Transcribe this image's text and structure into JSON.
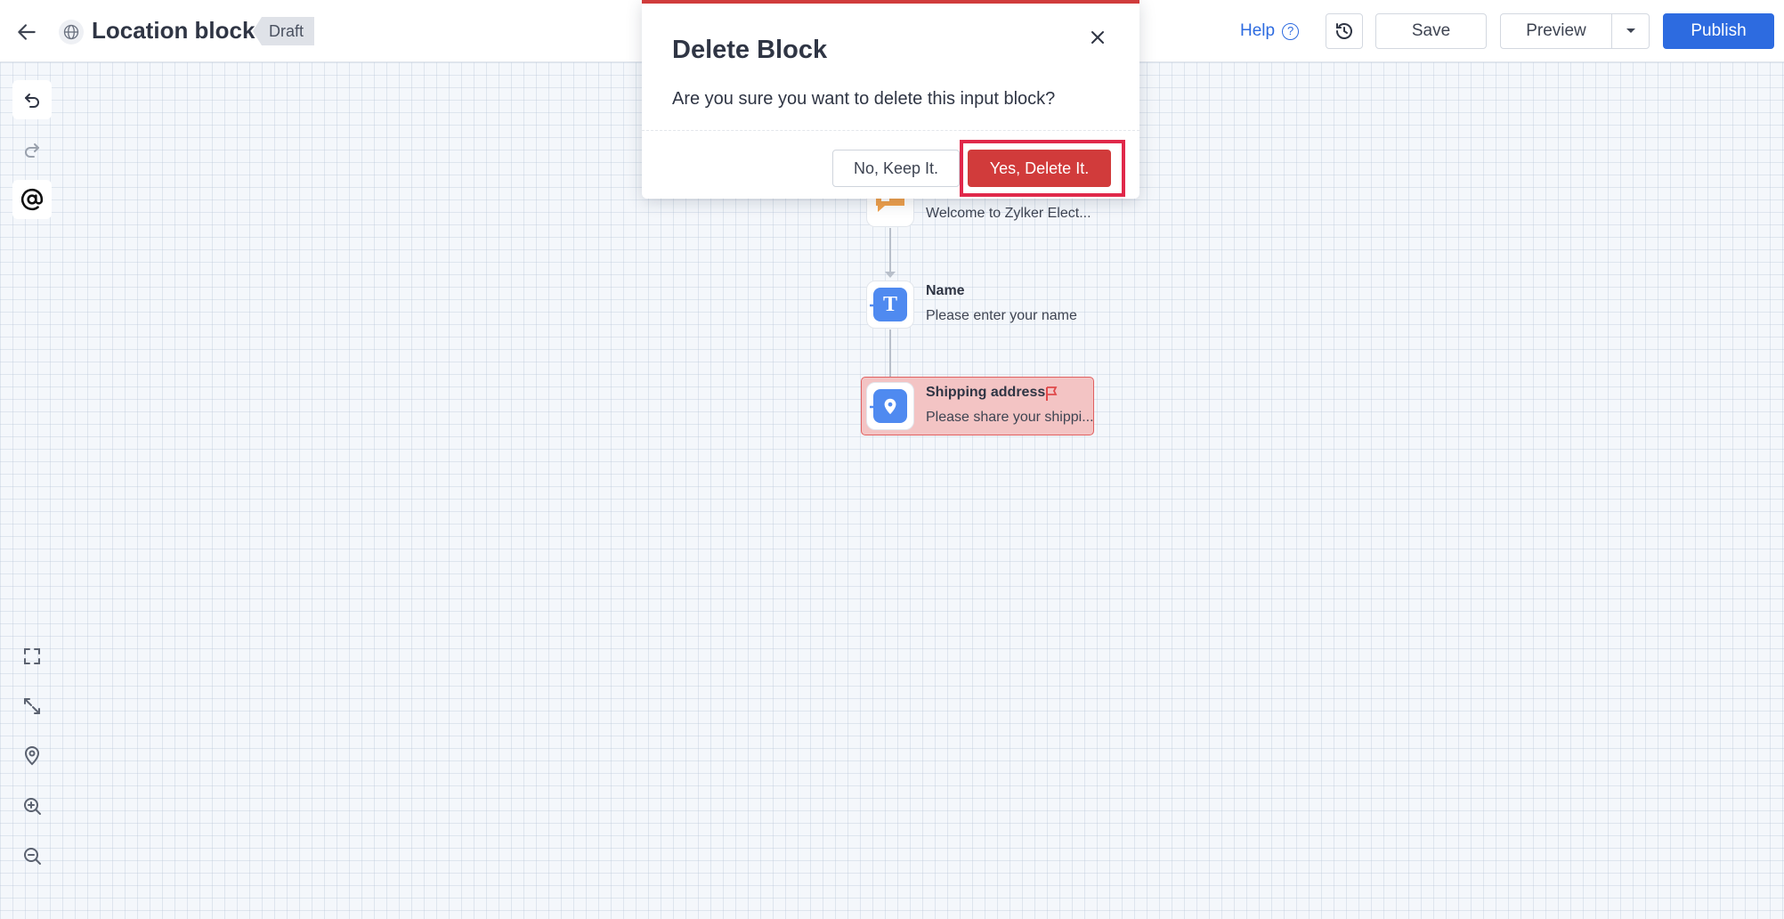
{
  "header": {
    "title": "Location block",
    "status": "Draft",
    "help_label": "Help",
    "help_glyph": "?",
    "save_label": "Save",
    "preview_label": "Preview",
    "publish_label": "Publish"
  },
  "flow": {
    "welcome": {
      "subtitle": "Welcome to Zylker Elect..."
    },
    "name_block": {
      "title": "Name",
      "subtitle": "Please enter your name",
      "icon_glyph": "T"
    },
    "shipping_block": {
      "title": "Shipping address",
      "subtitle": "Please share your shippi..."
    }
  },
  "dialog": {
    "title": "Delete Block",
    "message": "Are you sure you want to delete this input block?",
    "keep_label": "No, Keep It.",
    "delete_label": "Yes, Delete It."
  },
  "colors": {
    "accent": "#2d6be0",
    "danger": "#d13b3b",
    "highlight": "#e0284a",
    "selected_block_bg": "#f3c4c4",
    "message_icon": "#f0a04b",
    "input_icon": "#4f8af0"
  },
  "icons": {
    "back": "arrow-left-icon",
    "globe": "globe-icon",
    "help": "question-circle-icon",
    "history": "history-icon",
    "undo": "undo-icon",
    "redo": "redo-icon",
    "mention": "at-icon",
    "fullscreen": "fullscreen-icon",
    "fit": "expand-arrows-icon",
    "location": "location-pin-icon",
    "zoom_in": "zoom-in-icon",
    "zoom_out": "zoom-out-icon",
    "flag": "flag-icon",
    "close": "close-icon"
  }
}
